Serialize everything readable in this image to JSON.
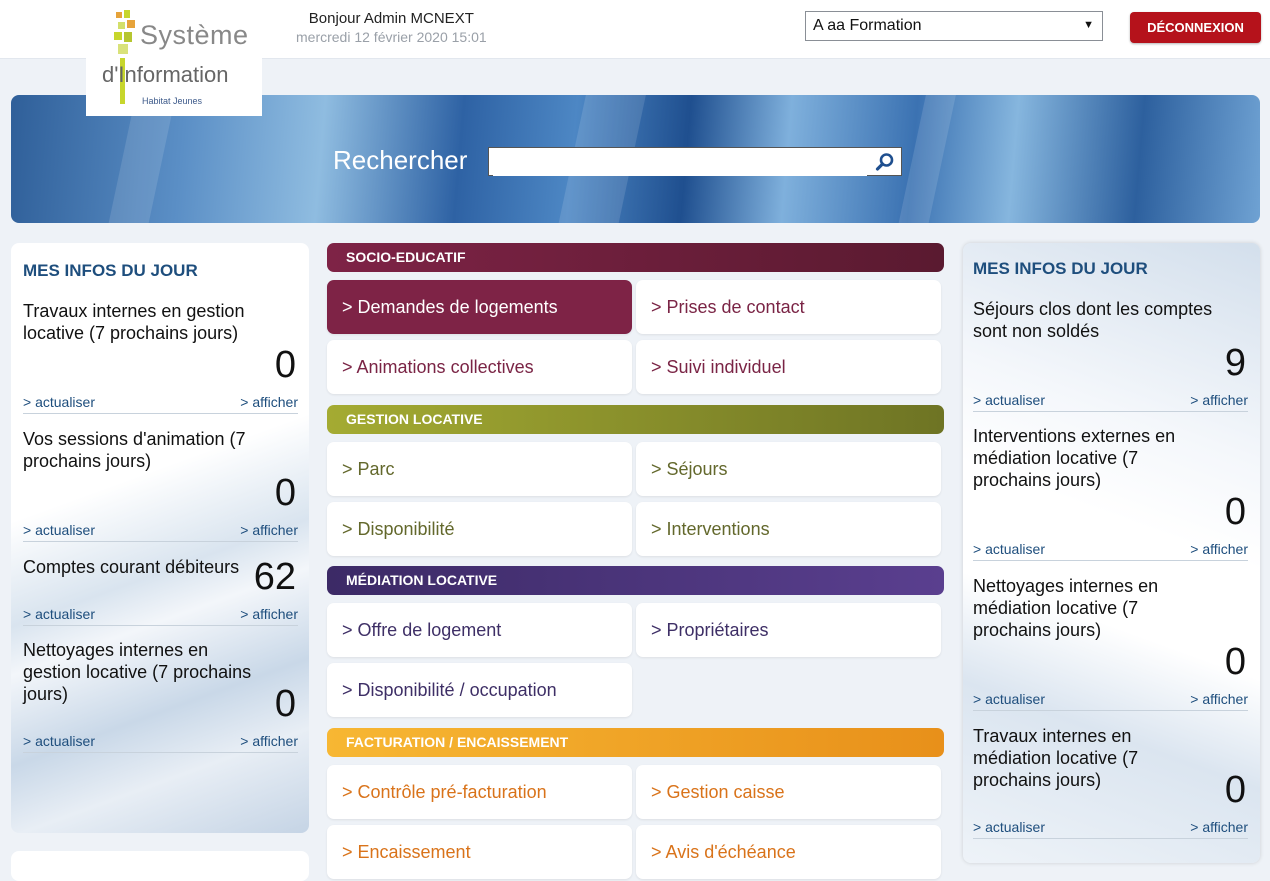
{
  "header": {
    "logo": {
      "line1": "Système",
      "line2": "d'Information",
      "line3": "Habitat Jeunes"
    },
    "greeting": "Bonjour Admin MCNEXT",
    "date": "mercredi 12 février 2020 15:01",
    "org_select": "A aa Formation",
    "logout_label": "DÉCONNEXION"
  },
  "search": {
    "label": "Rechercher",
    "value": ""
  },
  "left_panel": {
    "title": "MES INFOS DU JOUR",
    "items": [
      {
        "text": "Travaux internes en gestion locative (7 prochains jours)",
        "count": "0",
        "refresh": "> actualiser",
        "show": "> afficher"
      },
      {
        "text": "Vos sessions d'animation (7 prochains jours)",
        "count": "0",
        "refresh": "> actualiser",
        "show": "> afficher"
      },
      {
        "text": "Comptes courant débiteurs",
        "count": "62",
        "refresh": "> actualiser",
        "show": "> afficher"
      },
      {
        "text": "Nettoyages internes en gestion locative (7 prochains jours)",
        "count": "0",
        "refresh": "> actualiser",
        "show": "> afficher"
      }
    ]
  },
  "right_panel": {
    "title": "MES INFOS DU JOUR",
    "items": [
      {
        "text": "Séjours clos dont les comptes sont non soldés",
        "count": "9",
        "refresh": "> actualiser",
        "show": "> afficher"
      },
      {
        "text": "Interventions externes en médiation locative (7 prochains jours)",
        "count": "0",
        "refresh": "> actualiser",
        "show": "> afficher"
      },
      {
        "text": "Nettoyages internes en médiation locative (7 prochains jours)",
        "count": "0",
        "refresh": "> actualiser",
        "show": "> afficher"
      },
      {
        "text": "Travaux internes en médiation locative (7 prochains jours)",
        "count": "0",
        "refresh": "> actualiser",
        "show": "> afficher"
      }
    ]
  },
  "sections": [
    {
      "title": "SOCIO-EDUCATIF",
      "color": "#6e1f3c",
      "items": [
        "> Demandes de logements",
        "> Prises de contact",
        "> Animations collectives",
        "> Suivi individuel"
      ]
    },
    {
      "title": "GESTION LOCATIVE",
      "color": "#8a9128",
      "items": [
        "> Parc",
        "> Séjours",
        "> Disponibilité",
        "> Interventions"
      ]
    },
    {
      "title": "MÉDIATION LOCATIVE",
      "color": "#4a3578",
      "items": [
        "> Offre de logement",
        "> Propriétaires",
        "> Disponibilité / occupation"
      ]
    },
    {
      "title": "FACTURATION / ENCAISSEMENT",
      "color": "#f0a020",
      "items": [
        "> Contrôle pré-facturation",
        "> Gestion caisse",
        "> Encaissement",
        "> Avis d'échéance"
      ]
    }
  ],
  "icons": {
    "search": "magnifier-icon",
    "select": "triangle-down-icon"
  }
}
